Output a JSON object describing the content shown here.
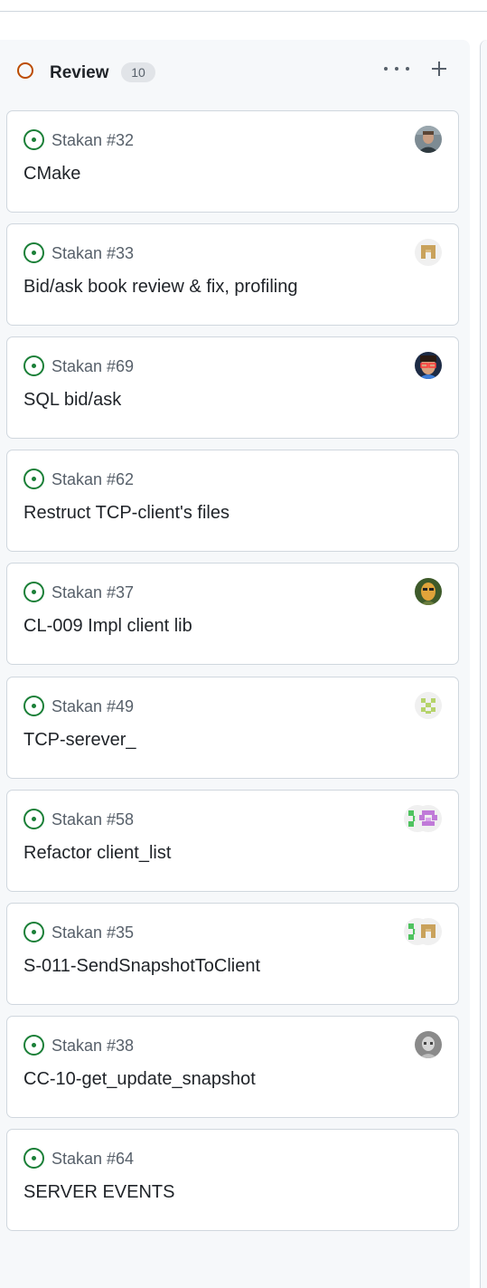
{
  "column": {
    "title": "Review",
    "count": "10",
    "status_color": "#bc4c00"
  },
  "cards": [
    {
      "ref": "Stakan #32",
      "title": "CMake",
      "assignees": [
        "photo-person"
      ]
    },
    {
      "ref": "Stakan #33",
      "title": "Bid/ask book review & fix, profiling",
      "assignees": [
        "identicon-tan"
      ]
    },
    {
      "ref": "Stakan #69",
      "title": "SQL bid/ask",
      "assignees": [
        "avatar-glasses"
      ]
    },
    {
      "ref": "Stakan #62",
      "title": "Restruct TCP-client's files",
      "assignees": []
    },
    {
      "ref": "Stakan #37",
      "title": "CL-009 Impl client lib",
      "assignees": [
        "avatar-yellow"
      ]
    },
    {
      "ref": "Stakan #49",
      "title": "TCP-serever_",
      "assignees": [
        "identicon-lime"
      ]
    },
    {
      "ref": "Stakan #58",
      "title": "Refactor client_list",
      "assignees": [
        "identicon-green",
        "identicon-purple"
      ]
    },
    {
      "ref": "Stakan #35",
      "title": "S-011-SendSnapshotToClient",
      "assignees": [
        "identicon-green",
        "identicon-tan"
      ]
    },
    {
      "ref": "Stakan #38",
      "title": "CC-10-get_update_snapshot",
      "assignees": [
        "photo-gray"
      ]
    },
    {
      "ref": "Stakan #64",
      "title": "SERVER EVENTS",
      "assignees": []
    }
  ],
  "colors": {
    "open_issue": "#1a7f37",
    "border": "#d0d7de",
    "column_bg": "#f6f8fa"
  }
}
